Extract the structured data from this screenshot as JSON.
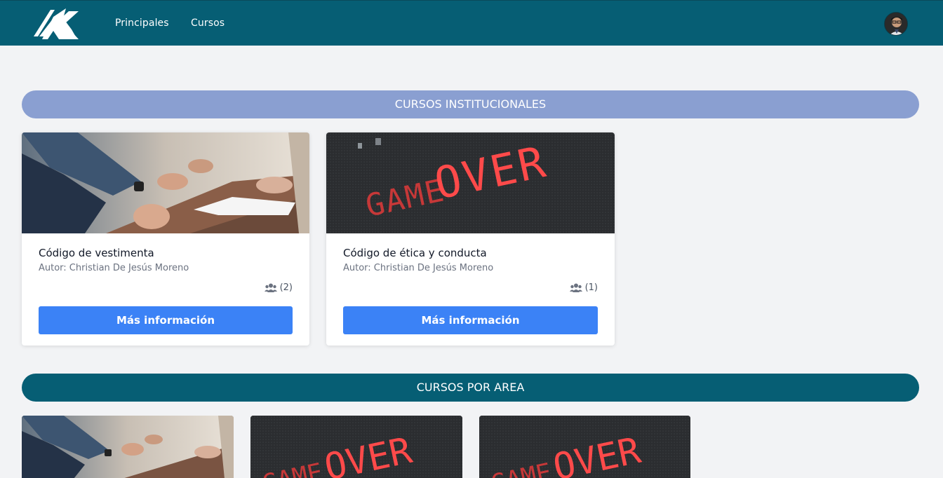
{
  "nav": {
    "links": [
      "Principales",
      "Cursos"
    ]
  },
  "sections": {
    "institucionales": "CURSOS INSTITUCIONALES",
    "area": "CURSOS POR AREA"
  },
  "courses": [
    {
      "title": "Código de vestimenta",
      "author": "Autor: Christian De Jesús Moreno",
      "count": "(2)",
      "button": "Más información",
      "image": "meeting-photo"
    },
    {
      "title": "Código de ética y conducta",
      "author": "Autor: Christian De Jesús Moreno",
      "count": "(1)",
      "button": "Más información",
      "image": "game-over-sign"
    }
  ],
  "area_courses": [
    "meeting-photo",
    "game-over-sign",
    "game-over-sign"
  ],
  "colors": {
    "navbar": "#065e74",
    "section_institucionales": "#8a9fd1",
    "section_area": "#065e74",
    "button": "#3b82f6",
    "background": "#f2f3f5"
  }
}
